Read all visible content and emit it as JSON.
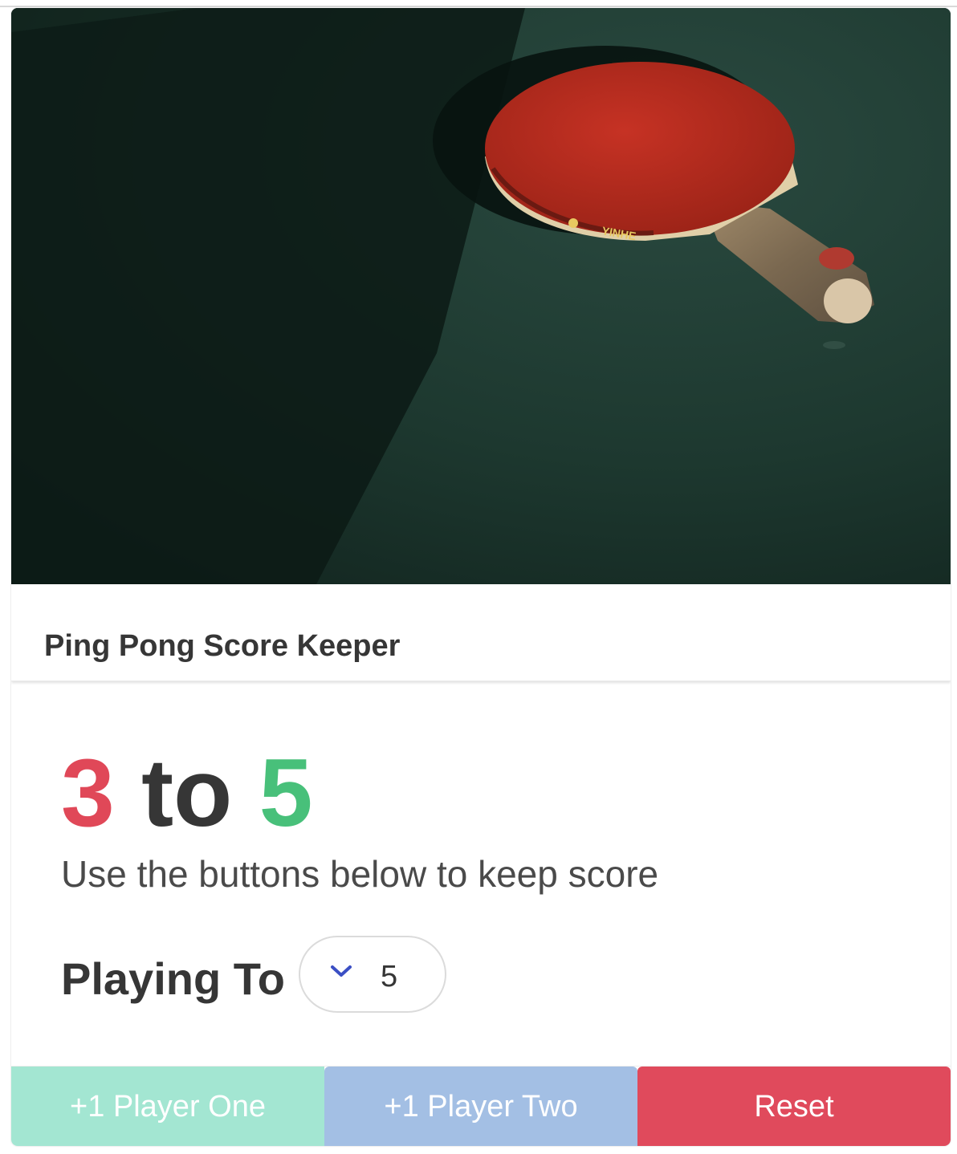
{
  "card": {
    "image_alt": "ping-pong-paddle",
    "title": "Ping Pong Score Keeper"
  },
  "score": {
    "player_one": "3",
    "separator": "to",
    "player_two": "5",
    "player_one_color": "#e04858",
    "player_two_color": "#48c07a"
  },
  "subtitle": "Use the buttons below to keep score",
  "playing_to": {
    "label": "Playing To",
    "selected_value": "5",
    "icon": "chevron-down-icon"
  },
  "buttons": {
    "player_one": "+1 Player One",
    "player_two": "+1 Player Two",
    "reset": "Reset",
    "player_one_color": "#a3e6d2",
    "player_two_color": "#a3bfe4",
    "reset_color": "#e04a5c"
  }
}
